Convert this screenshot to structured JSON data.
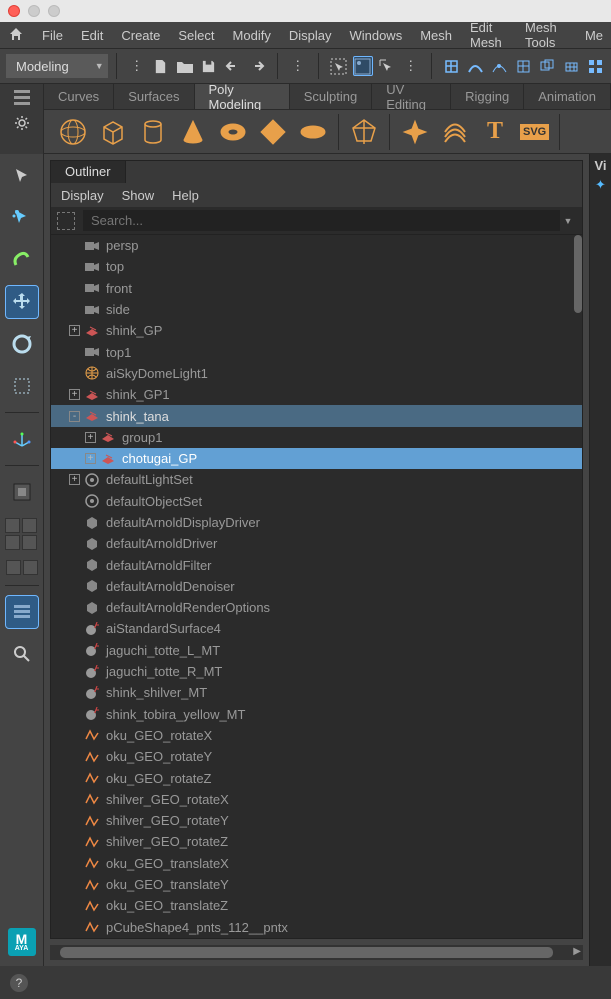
{
  "menubar": [
    "File",
    "Edit",
    "Create",
    "Select",
    "Modify",
    "Display",
    "Windows",
    "Mesh",
    "Edit Mesh",
    "Mesh Tools",
    "Me"
  ],
  "mode_dropdown": "Modeling",
  "shelf_tabs": [
    "Curves",
    "Surfaces",
    "Poly Modeling",
    "Sculpting",
    "UV Editing",
    "Rigging",
    "Animation"
  ],
  "shelf_active_index": 2,
  "outliner": {
    "tab_label": "Outliner",
    "menu": [
      "Display",
      "Show",
      "Help"
    ],
    "search_placeholder": "Search...",
    "right_strip": "Vi",
    "scrollbar": {
      "thumb_ratio": 0.11
    }
  },
  "tree": [
    {
      "depth": 1,
      "expand": "",
      "icon": "camera",
      "label": "persp",
      "sel": "none"
    },
    {
      "depth": 1,
      "expand": "",
      "icon": "camera",
      "label": "top",
      "sel": "none"
    },
    {
      "depth": 1,
      "expand": "",
      "icon": "camera",
      "label": "front",
      "sel": "none"
    },
    {
      "depth": 1,
      "expand": "",
      "icon": "camera",
      "label": "side",
      "sel": "none"
    },
    {
      "depth": 1,
      "expand": "+",
      "icon": "group",
      "label": "shink_GP",
      "sel": "none"
    },
    {
      "depth": 1,
      "expand": "",
      "icon": "camera",
      "label": "top1",
      "sel": "none"
    },
    {
      "depth": 1,
      "expand": "",
      "icon": "skydome",
      "label": "aiSkyDomeLight1",
      "sel": "none"
    },
    {
      "depth": 1,
      "expand": "+",
      "icon": "group",
      "label": "shink_GP1",
      "sel": "none"
    },
    {
      "depth": 1,
      "expand": "-",
      "icon": "group",
      "label": "shink_tana",
      "sel": "dark"
    },
    {
      "depth": 2,
      "expand": "+",
      "icon": "group",
      "label": "group1",
      "sel": "none"
    },
    {
      "depth": 2,
      "expand": "+",
      "icon": "group",
      "label": "chotugai_GP",
      "sel": "light"
    },
    {
      "depth": 1,
      "expand": "+",
      "icon": "set",
      "label": "defaultLightSet",
      "sel": "none"
    },
    {
      "depth": 1,
      "expand": "",
      "icon": "set",
      "label": "defaultObjectSet",
      "sel": "none"
    },
    {
      "depth": 1,
      "expand": "",
      "icon": "node",
      "label": "defaultArnoldDisplayDriver",
      "sel": "none"
    },
    {
      "depth": 1,
      "expand": "",
      "icon": "node",
      "label": "defaultArnoldDriver",
      "sel": "none"
    },
    {
      "depth": 1,
      "expand": "",
      "icon": "node",
      "label": "defaultArnoldFilter",
      "sel": "none"
    },
    {
      "depth": 1,
      "expand": "",
      "icon": "node",
      "label": "defaultArnoldDenoiser",
      "sel": "none"
    },
    {
      "depth": 1,
      "expand": "",
      "icon": "node",
      "label": "defaultArnoldRenderOptions",
      "sel": "none"
    },
    {
      "depth": 1,
      "expand": "",
      "icon": "material",
      "label": "aiStandardSurface4",
      "sel": "none"
    },
    {
      "depth": 1,
      "expand": "",
      "icon": "material",
      "label": "jaguchi_totte_L_MT",
      "sel": "none"
    },
    {
      "depth": 1,
      "expand": "",
      "icon": "material",
      "label": "jaguchi_totte_R_MT",
      "sel": "none"
    },
    {
      "depth": 1,
      "expand": "",
      "icon": "material",
      "label": "shink_shilver_MT",
      "sel": "none"
    },
    {
      "depth": 1,
      "expand": "",
      "icon": "material",
      "label": "shink_tobira_yellow_MT",
      "sel": "none"
    },
    {
      "depth": 1,
      "expand": "",
      "icon": "anim",
      "label": "oku_GEO_rotateX",
      "sel": "none"
    },
    {
      "depth": 1,
      "expand": "",
      "icon": "anim",
      "label": "oku_GEO_rotateY",
      "sel": "none"
    },
    {
      "depth": 1,
      "expand": "",
      "icon": "anim",
      "label": "oku_GEO_rotateZ",
      "sel": "none"
    },
    {
      "depth": 1,
      "expand": "",
      "icon": "anim",
      "label": "shilver_GEO_rotateX",
      "sel": "none"
    },
    {
      "depth": 1,
      "expand": "",
      "icon": "anim",
      "label": "shilver_GEO_rotateY",
      "sel": "none"
    },
    {
      "depth": 1,
      "expand": "",
      "icon": "anim",
      "label": "shilver_GEO_rotateZ",
      "sel": "none"
    },
    {
      "depth": 1,
      "expand": "",
      "icon": "anim",
      "label": "oku_GEO_translateX",
      "sel": "none"
    },
    {
      "depth": 1,
      "expand": "",
      "icon": "anim",
      "label": "oku_GEO_translateY",
      "sel": "none"
    },
    {
      "depth": 1,
      "expand": "",
      "icon": "anim",
      "label": "oku_GEO_translateZ",
      "sel": "none"
    },
    {
      "depth": 1,
      "expand": "",
      "icon": "anim",
      "label": "pCubeShape4_pnts_112__pntx",
      "sel": "none"
    }
  ],
  "footer_help": "?"
}
